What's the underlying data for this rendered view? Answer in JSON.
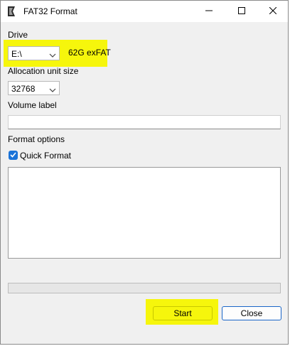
{
  "window": {
    "title": "FAT32 Format",
    "icon": "fat32-format-app-icon"
  },
  "titlebar_buttons": {
    "minimize": "minimize-icon",
    "maximize": "maximize-icon",
    "close": "close-icon"
  },
  "drive": {
    "label": "Drive",
    "selected": "E:\\",
    "info": "62G exFAT"
  },
  "allocation": {
    "label": "Allocation unit size",
    "selected": "32768"
  },
  "volume": {
    "label": "Volume label",
    "value": ""
  },
  "format_options": {
    "label": "Format options",
    "quick_format_label": "Quick Format",
    "quick_format_checked": true
  },
  "log": {
    "text": ""
  },
  "progress": {
    "value": 0
  },
  "buttons": {
    "start": "Start",
    "close": "Close"
  },
  "colors": {
    "highlight": "#f6f60c",
    "checkbox_accent": "#1a73d8",
    "close_button_border": "#1a66c8"
  }
}
